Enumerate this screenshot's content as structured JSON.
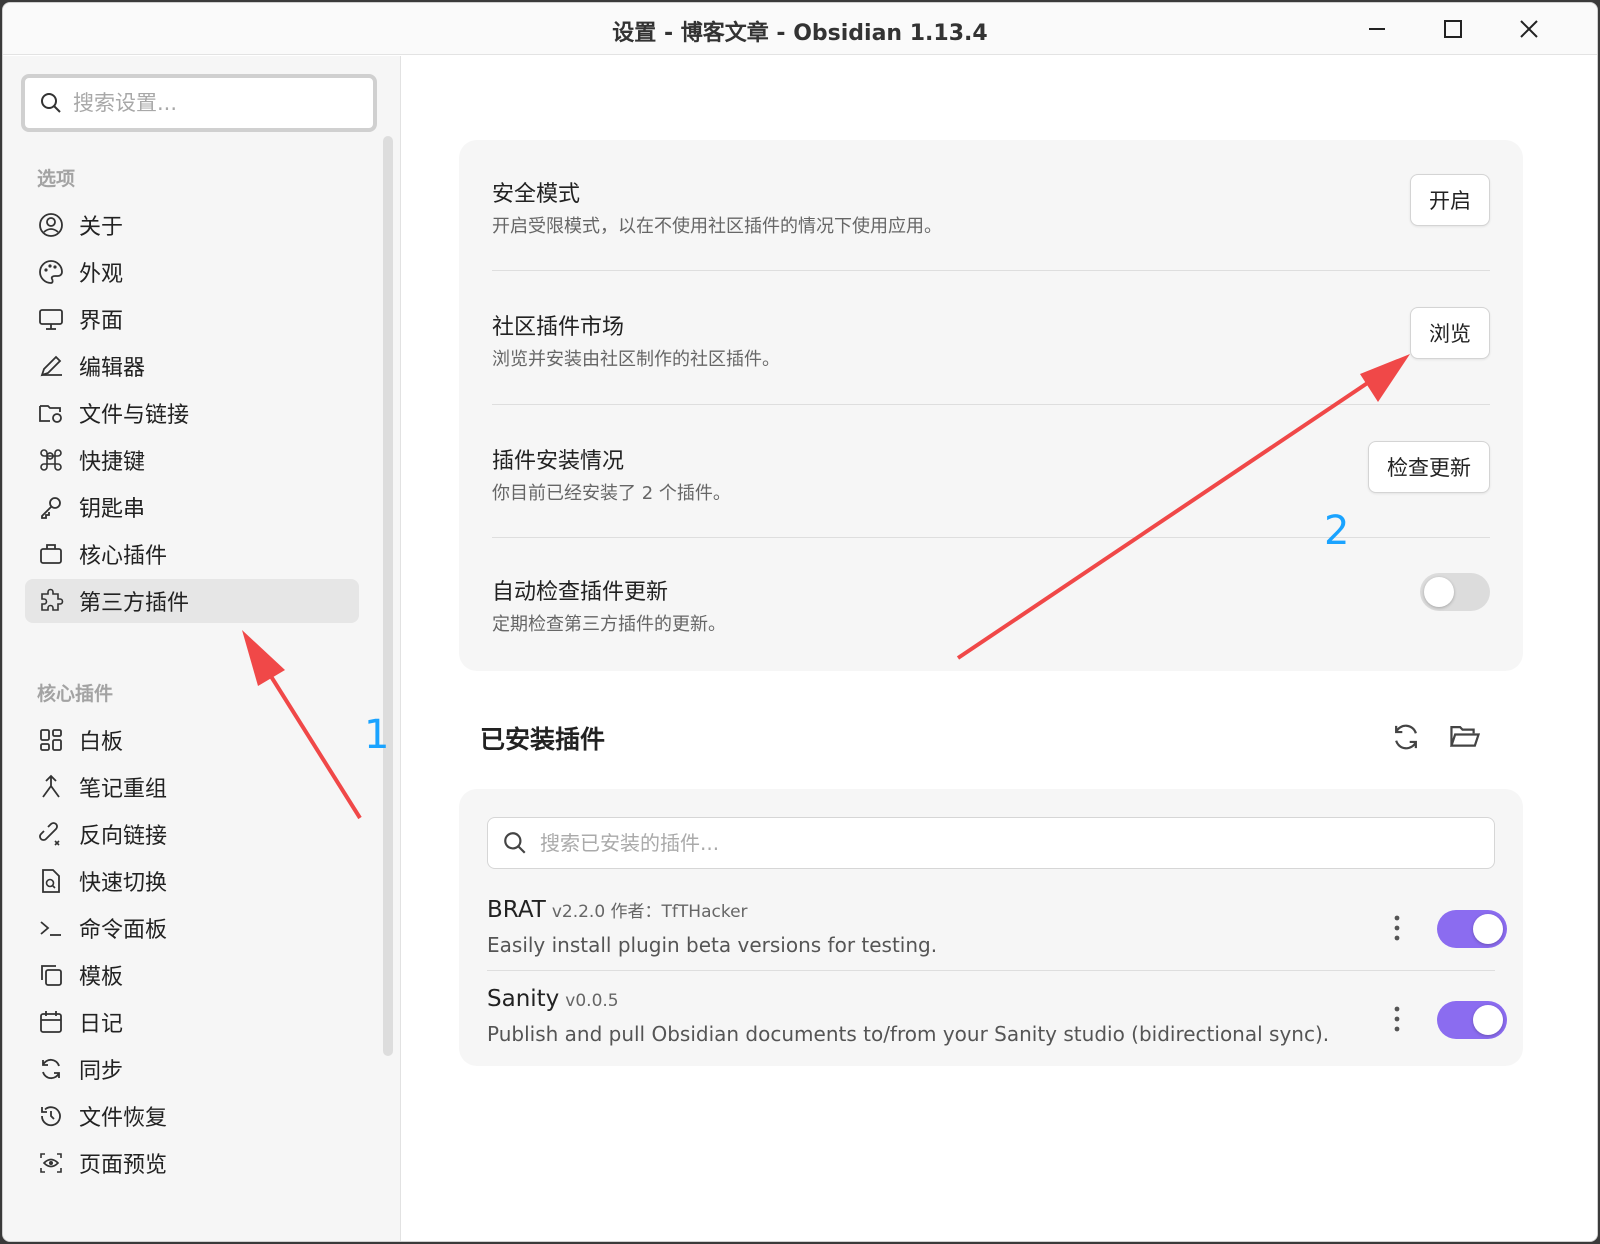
{
  "window": {
    "title": "设置 - 博客文章 - Obsidian 1.13.4"
  },
  "sidebar": {
    "search_placeholder": "搜索设置...",
    "sections": [
      {
        "label": "选项"
      },
      {
        "label": "核心插件"
      }
    ],
    "options": [
      {
        "label": "关于",
        "icon": "user-circle-icon"
      },
      {
        "label": "外观",
        "icon": "palette-icon"
      },
      {
        "label": "界面",
        "icon": "monitor-icon"
      },
      {
        "label": "编辑器",
        "icon": "pencil-icon"
      },
      {
        "label": "文件与链接",
        "icon": "folder-link-icon"
      },
      {
        "label": "快捷键",
        "icon": "command-icon"
      },
      {
        "label": "钥匙串",
        "icon": "key-icon"
      },
      {
        "label": "核心插件",
        "icon": "briefcase-icon"
      },
      {
        "label": "第三方插件",
        "icon": "puzzle-icon",
        "active": true
      }
    ],
    "core_plugins": [
      {
        "label": "白板",
        "icon": "layout-grid-icon"
      },
      {
        "label": "笔记重组",
        "icon": "merge-icon"
      },
      {
        "label": "反向链接",
        "icon": "backlink-icon"
      },
      {
        "label": "快速切换",
        "icon": "file-search-icon"
      },
      {
        "label": "命令面板",
        "icon": "terminal-icon"
      },
      {
        "label": "模板",
        "icon": "copy-icon"
      },
      {
        "label": "日记",
        "icon": "calendar-icon"
      },
      {
        "label": "同步",
        "icon": "sync-icon"
      },
      {
        "label": "文件恢复",
        "icon": "history-icon"
      },
      {
        "label": "页面预览",
        "icon": "eye-scan-icon"
      }
    ]
  },
  "settings": [
    {
      "name": "安全模式",
      "desc": "开启受限模式，以在不使用社区插件的情况下使用应用。",
      "button": "开启"
    },
    {
      "name": "社区插件市场",
      "desc": "浏览并安装由社区制作的社区插件。",
      "button": "浏览"
    },
    {
      "name": "插件安装情况",
      "desc": "你目前已经安装了 2 个插件。",
      "button": "检查更新"
    },
    {
      "name": "自动检查插件更新",
      "desc": "定期检查第三方插件的更新。",
      "toggle": false
    }
  ],
  "installed": {
    "title": "已安装插件",
    "search_placeholder": "搜索已安装的插件...",
    "plugins": [
      {
        "name": "BRAT",
        "meta": "v2.2.0 作者：TfTHacker",
        "desc": "Easily install plugin beta versions for testing.",
        "enabled": true
      },
      {
        "name": "Sanity",
        "meta": "v0.0.5",
        "desc": "Publish and pull Obsidian documents to/from your Sanity studio (bidirectional sync).",
        "enabled": true
      }
    ]
  },
  "annotations": [
    {
      "label": "1",
      "color": "#1aa3ff"
    },
    {
      "label": "2",
      "color": "#1aa3ff"
    }
  ],
  "colors": {
    "accent": "#8b6cf0",
    "arrow": "#f04848",
    "annotation": "#1aa3ff"
  }
}
